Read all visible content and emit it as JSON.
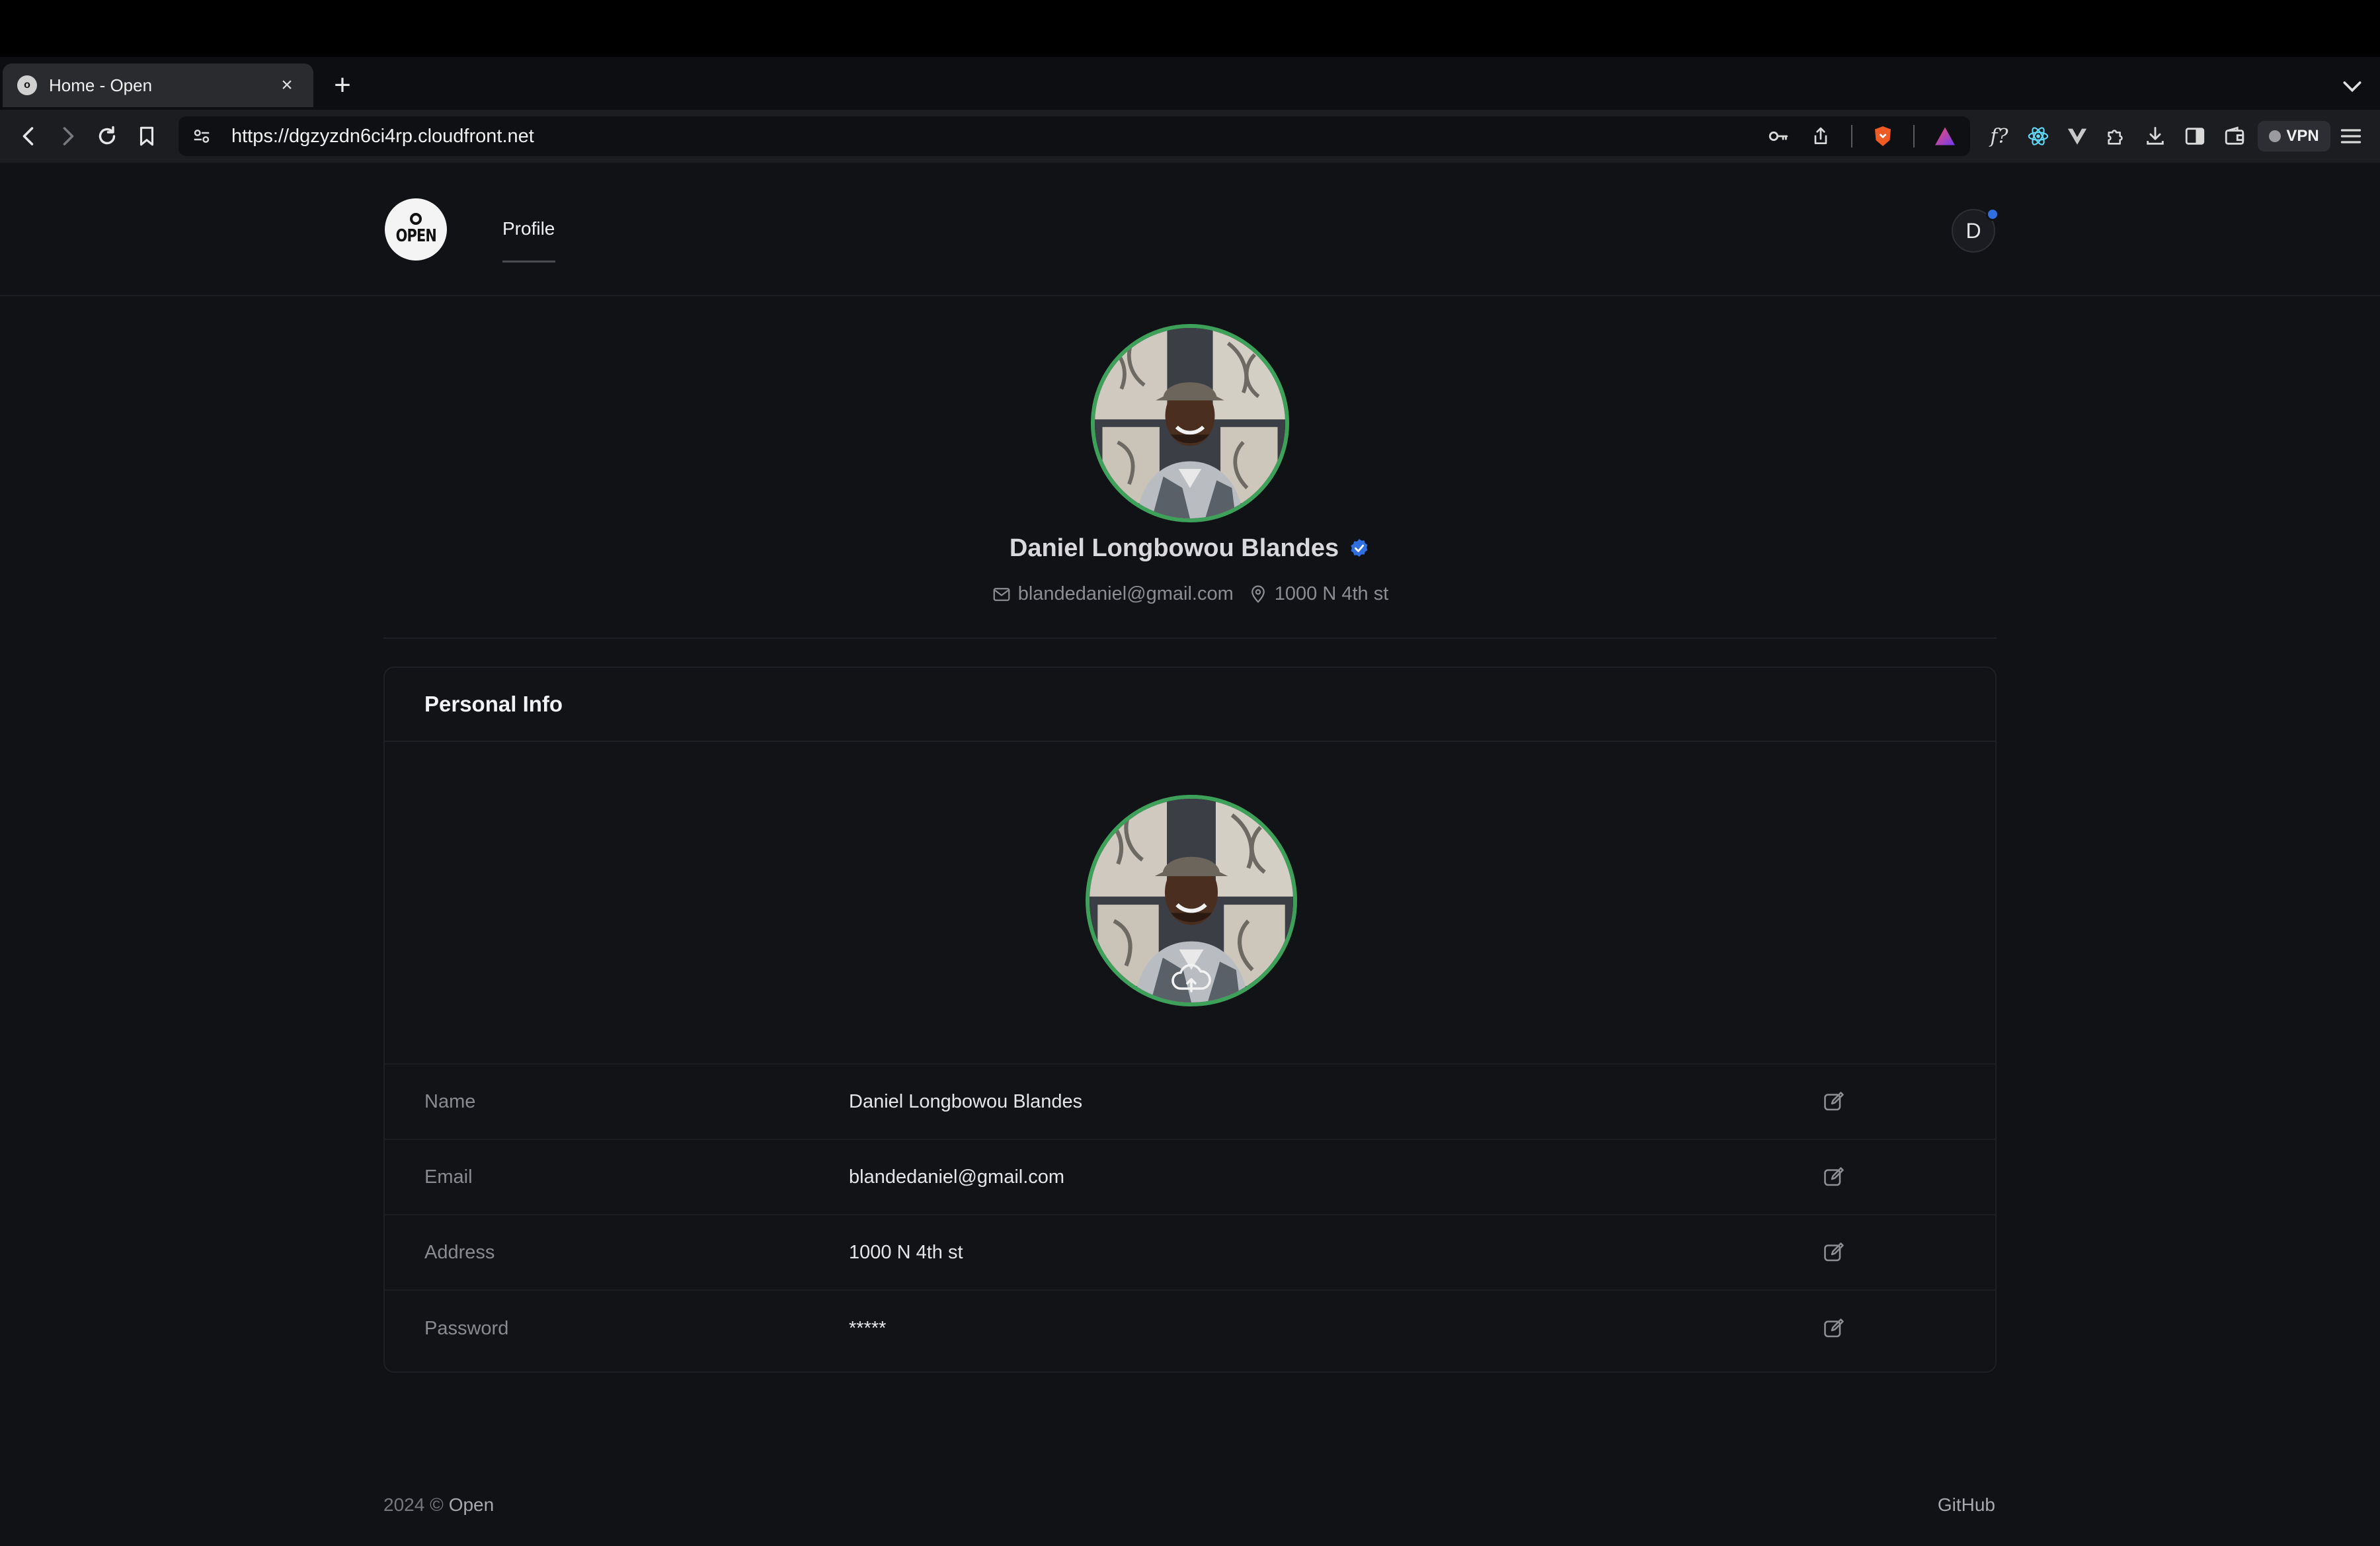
{
  "browser": {
    "tab_title": "Home - Open",
    "tab_favicon": "open-logo",
    "url": "https://dgzyzdn6ci4rp.cloudfront.net",
    "vpn_label": "VPN"
  },
  "site": {
    "logo_text": "OPEN",
    "nav": {
      "profile": "Profile"
    },
    "avatar_initial": "D"
  },
  "profile": {
    "name": "Daniel Longbowou Blandes",
    "email": "blandedaniel@gmail.com",
    "address": "1000 N 4th st",
    "verified": true
  },
  "personal_info": {
    "title": "Personal Info",
    "rows": [
      {
        "label": "Name",
        "value": "Daniel Longbowou Blandes"
      },
      {
        "label": "Email",
        "value": "blandedaniel@gmail.com"
      },
      {
        "label": "Address",
        "value": "1000 N 4th st"
      },
      {
        "label": "Password",
        "value": "*****"
      }
    ]
  },
  "footer": {
    "year_text": "2024 ©",
    "brand": "Open",
    "github": "GitHub"
  },
  "colors": {
    "accent_green": "#3ea15a",
    "verified_blue": "#2f6fe0",
    "background": "#111216"
  }
}
